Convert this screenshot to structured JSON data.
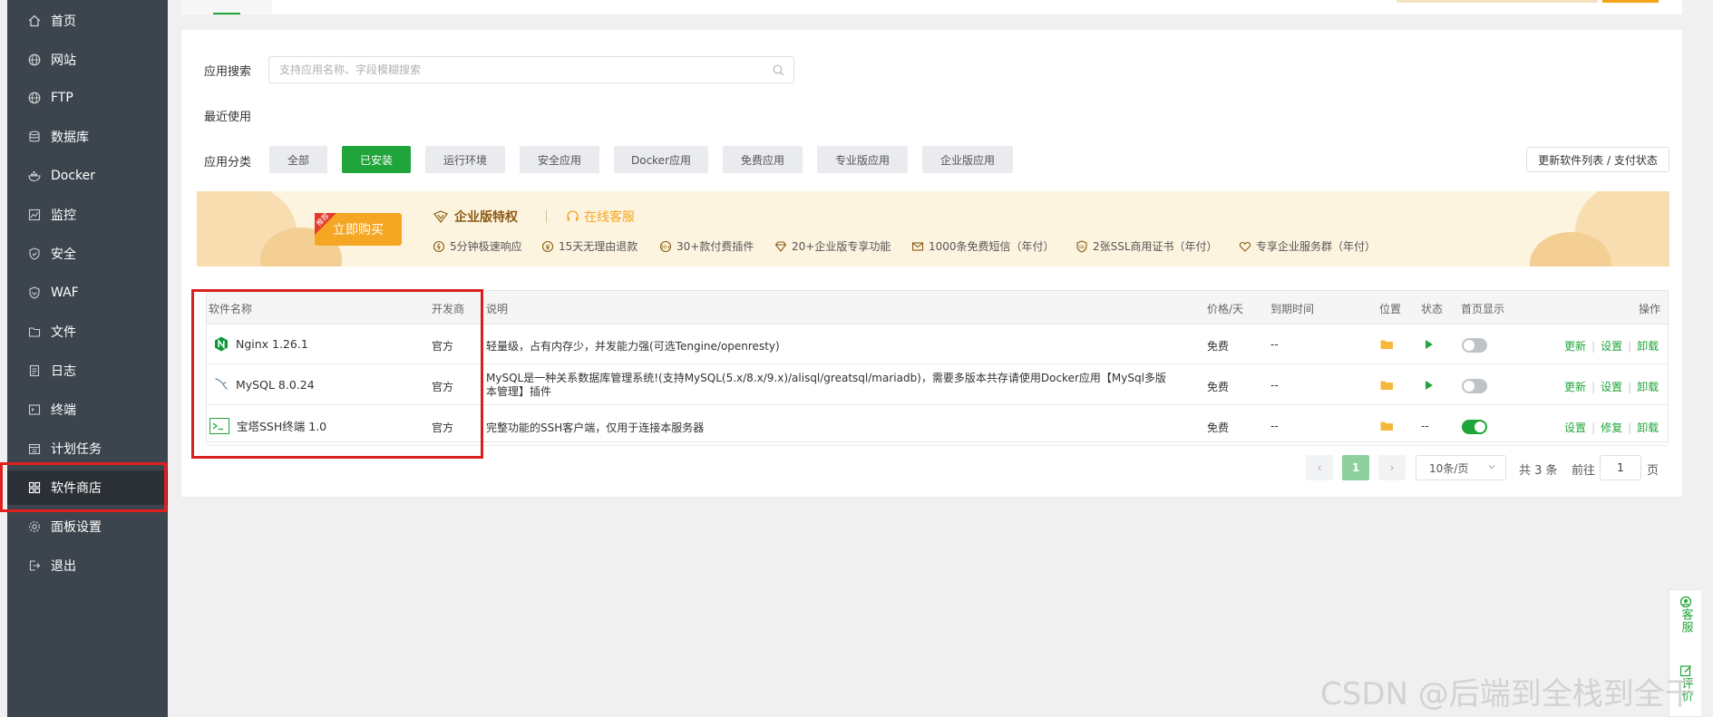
{
  "colors": {
    "accent": "#20a53a",
    "sidebar_bg": "#3c444d",
    "gold": "#f5a623",
    "highlight_red": "#d9201f"
  },
  "sidebar": {
    "items": [
      {
        "label": "首页",
        "icon": "home-icon"
      },
      {
        "label": "网站",
        "icon": "globe-icon"
      },
      {
        "label": "FTP",
        "icon": "ftp-globe-icon"
      },
      {
        "label": "数据库",
        "icon": "database-icon"
      },
      {
        "label": "Docker",
        "icon": "docker-icon"
      },
      {
        "label": "监控",
        "icon": "monitor-icon"
      },
      {
        "label": "安全",
        "icon": "shield-icon"
      },
      {
        "label": "WAF",
        "icon": "waf-shield-icon"
      },
      {
        "label": "文件",
        "icon": "folder-icon"
      },
      {
        "label": "日志",
        "icon": "log-icon"
      },
      {
        "label": "终端",
        "icon": "terminal-icon"
      },
      {
        "label": "计划任务",
        "icon": "calendar-icon"
      },
      {
        "label": "软件商店",
        "icon": "grid-apps-icon",
        "active": true
      },
      {
        "label": "面板设置",
        "icon": "gear-icon"
      },
      {
        "label": "退出",
        "icon": "logout-icon"
      }
    ]
  },
  "search": {
    "label": "应用搜索",
    "placeholder": "支持应用名称、字段模糊搜索",
    "value": ""
  },
  "recent": {
    "label": "最近使用"
  },
  "categories": {
    "label": "应用分类",
    "items": [
      "全部",
      "已安装",
      "运行环境",
      "安全应用",
      "Docker应用",
      "免费应用",
      "专业版应用",
      "企业版应用"
    ],
    "active": "已安装",
    "refresh_label": "更新软件列表 / 支付状态"
  },
  "banner": {
    "buy_label": "立即购买",
    "ribbon_label": "推荐",
    "enterprise_title": "企业版特权",
    "service_title": "在线客服",
    "features": [
      "5分钟极速响应",
      "15天无理由退款",
      "30+款付费插件",
      "20+企业版专享功能",
      "1000条免费短信（年付）",
      "2张SSL商用证书（年付）",
      "专享企业服务群（年付）"
    ]
  },
  "table": {
    "headers": {
      "name": "软件名称",
      "developer": "开发商",
      "desc": "说明",
      "price": "价格/天",
      "expire": "到期时间",
      "location": "位置",
      "status": "状态",
      "homepage": "首页显示",
      "actions": "操作"
    },
    "rows": [
      {
        "name": "Nginx 1.26.1",
        "icon": "nginx-icon",
        "developer": "官方",
        "desc": "轻量级，占有内存少，并发能力强(可选Tengine/openresty)",
        "price": "免费",
        "expire": "--",
        "status": "running",
        "homepage_on": false,
        "actions": [
          "更新",
          "设置",
          "卸载"
        ]
      },
      {
        "name": "MySQL 8.0.24",
        "icon": "mysql-icon",
        "developer": "官方",
        "desc": "MySQL是一种关系数据库管理系统!(支持MySQL(5.x/8.x/9.x)/alisql/greatsql/mariadb)，需要多版本共存请使用Docker应用【MySql多版本管理】插件",
        "price": "免费",
        "expire": "--",
        "status": "running",
        "homepage_on": false,
        "actions": [
          "更新",
          "设置",
          "卸载"
        ]
      },
      {
        "name": "宝塔SSH终端 1.0",
        "icon": "ssh-terminal-icon",
        "developer": "官方",
        "desc": "完整功能的SSH客户端，仅用于连接本服务器",
        "price": "免费",
        "expire": "--",
        "status_text": "--",
        "homepage_on": true,
        "actions": [
          "设置",
          "修复",
          "卸载"
        ]
      }
    ]
  },
  "pagination": {
    "current": "1",
    "page_size": "10条/页",
    "total": "共 3 条",
    "goto_label": "前往",
    "goto_value": "1",
    "page_unit": "页"
  },
  "float_tools": {
    "service": "客服",
    "rate": "评价"
  },
  "watermark": "CSDN @后端到全栈到全干"
}
